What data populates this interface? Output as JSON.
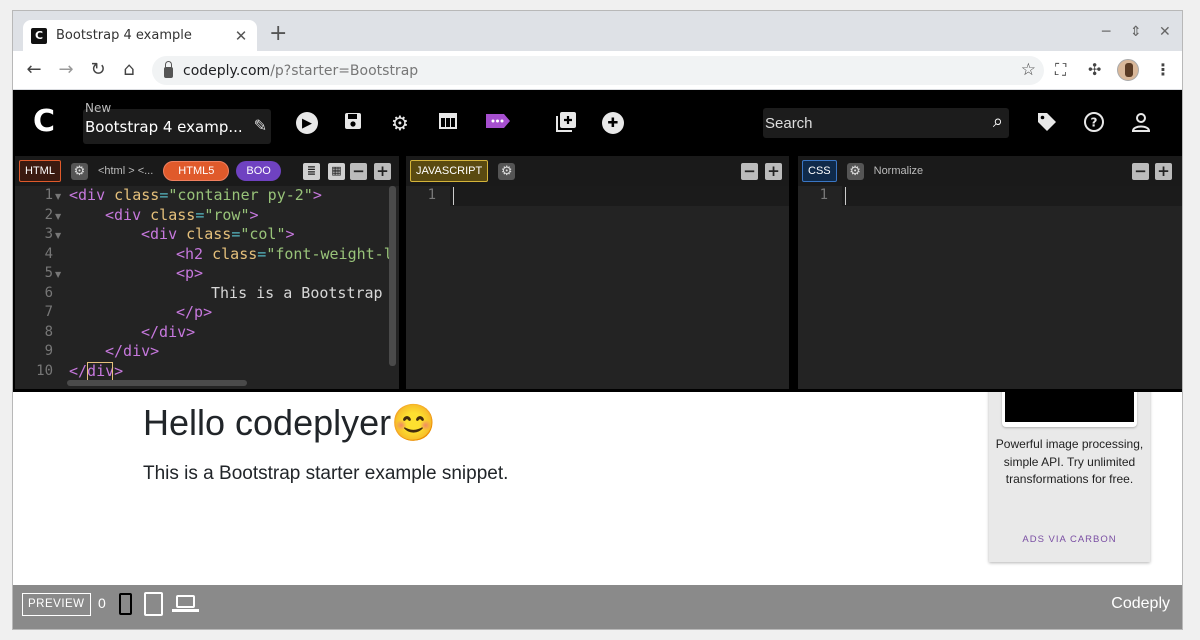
{
  "browser": {
    "tab_title": "Bootstrap 4 example",
    "favicon_letter": "C",
    "url_host": "codeply.com",
    "url_path": "/p?starter=Bootstrap"
  },
  "header": {
    "logo": "C",
    "new_label": "New",
    "project_name": "Bootstrap 4 examp...",
    "search_placeholder": "Search"
  },
  "html_pane": {
    "badge": "HTML",
    "crumb": "<html > <...",
    "html5_pill": "HTML5",
    "framework_pill": "BOO",
    "line_numbers": [
      "1",
      "2",
      "3",
      "4",
      "5",
      "6",
      "7",
      "8",
      "9",
      "10"
    ]
  },
  "js_pane": {
    "badge": "JAVASCRIPT",
    "line_number": "1"
  },
  "css_pane": {
    "badge": "CSS",
    "normalize": "Normalize",
    "line_number": "1"
  },
  "code": {
    "l1_open": "<div",
    "l1_attr": "class",
    "l1_str": "\"container py-2\"",
    "l1_close": ">",
    "l2_open": "<div",
    "l2_attr": "class",
    "l2_str": "\"row\"",
    "l2_close": ">",
    "l3_open": "<div",
    "l3_attr": "class",
    "l3_str": "\"col\"",
    "l3_close": ">",
    "l4_open": "<h2",
    "l4_attr": "class",
    "l4_str": "\"font-weight-l",
    "l5_tag": "<p>",
    "l6_text": "This is a Bootstrap",
    "l7_tag": "</p>",
    "l8_tag": "</div>",
    "l9_tag": "</div>",
    "l10_tag": "</div>"
  },
  "preview": {
    "heading": "Hello codeplyer😊",
    "lead": "This is a Bootstrap starter example snippet.",
    "ad_text": "Powerful image processing, simple API. Try unlimited transformations for free.",
    "ad_carbon": "ADS VIA CARBON"
  },
  "footer": {
    "preview_label": "PREVIEW",
    "count": "0",
    "brand": "Codeply"
  },
  "colors": {
    "html_badge": "#e05a2b",
    "js_badge": "#d4b43a",
    "css_badge": "#3a76c4",
    "html5_pill": "#e05a2b",
    "boo_pill": "#6f42c1",
    "tag_accent": "#a64fcf"
  }
}
